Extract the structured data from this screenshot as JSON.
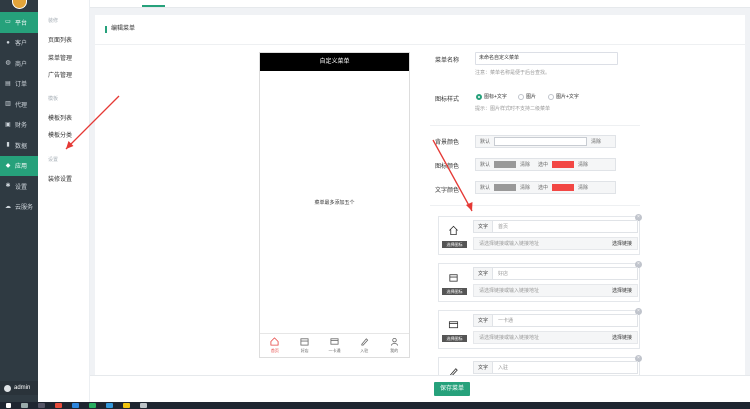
{
  "sidebar": {
    "items": [
      {
        "label": "平台",
        "icon": "monitor-icon",
        "active": true
      },
      {
        "label": "客户",
        "icon": "user-icon"
      },
      {
        "label": "商户",
        "icon": "users-icon"
      },
      {
        "label": "订单",
        "icon": "document-icon"
      },
      {
        "label": "代理",
        "icon": "book-icon"
      },
      {
        "label": "财务",
        "icon": "finance-icon"
      },
      {
        "label": "数据",
        "icon": "chart-icon"
      },
      {
        "label": "应用",
        "icon": "app-icon",
        "active": true
      },
      {
        "label": "设置",
        "icon": "gear-icon"
      },
      {
        "label": "云服务",
        "icon": "cloud-icon"
      }
    ],
    "user": "admin"
  },
  "subnav": {
    "group1": "装修",
    "items1": [
      "页面列表",
      "菜单管理",
      "广告管理"
    ],
    "group2": "模板",
    "items2": [
      "模板列表",
      "模板分类"
    ],
    "group3": "设置",
    "items3": [
      "装修设置"
    ]
  },
  "card": {
    "title": "编辑菜单"
  },
  "preview": {
    "title": "自定义菜单",
    "hint": "菜单最多添加五个",
    "tabs": [
      "首页",
      "好店",
      "一卡通",
      "入驻",
      "我的"
    ]
  },
  "form": {
    "name_label": "菜单名称",
    "name_value": "未命名自定义菜单",
    "name_note": "注意：菜单名称是便于后台查找。",
    "style_label": "图标样式",
    "style_options": [
      "图标+文字",
      "图片",
      "图片+文字"
    ],
    "style_note": "提示：图片样式时不支持二级菜单",
    "bg_label": "背景颜色",
    "icon_color_label": "图标颜色",
    "text_color_label": "文字颜色",
    "default": "默认",
    "clear": "清除",
    "selected": "选中",
    "colors": {
      "gray": "#999999",
      "red": "#f24744"
    }
  },
  "items": [
    {
      "text_label": "文字",
      "text": "首页",
      "icon": "home-icon"
    },
    {
      "text_label": "文字",
      "text": "好店",
      "icon": "shop-icon"
    },
    {
      "text_label": "文字",
      "text": "一卡通",
      "icon": "card-icon"
    },
    {
      "text_label": "文字",
      "text": "入驻",
      "icon": "pen-icon"
    }
  ],
  "item_common": {
    "pick_icon": "选择图标",
    "link_placeholder": "请选择链接或输入链接地址",
    "choose_link": "选择链接"
  },
  "footer": {
    "save": "保存菜单"
  }
}
